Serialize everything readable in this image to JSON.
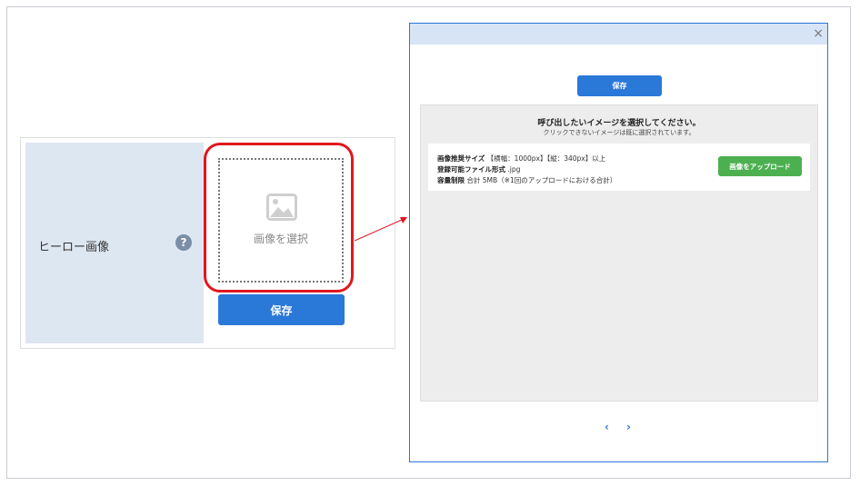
{
  "form": {
    "label": "ヒーロー画像",
    "help_icon": "?",
    "select_image_label": "画像を選択",
    "save_label": "保存"
  },
  "modal": {
    "close_icon": "×",
    "save_label": "保存",
    "title": "呼び出したいイメージを選択してください。",
    "subtitle": "クリックできないイメージは既に選択されています。",
    "info": {
      "size_label": "画像推奨サイズ",
      "size_value": "【横幅：1000px】【縦：340px】以上",
      "format_label": "登録可能ファイル形式",
      "format_value": ".jpg",
      "limit_label": "容量制限",
      "limit_value": "合計 5MB（※1回のアップロードにおける合計）"
    },
    "upload_label": "画像をアップロード",
    "pager_prev": "‹",
    "pager_next": "›"
  },
  "colors": {
    "primary": "#2a78d8",
    "upload_green": "#4caf50",
    "highlight_red": "#e0181e",
    "label_bg": "#dde7f2"
  }
}
